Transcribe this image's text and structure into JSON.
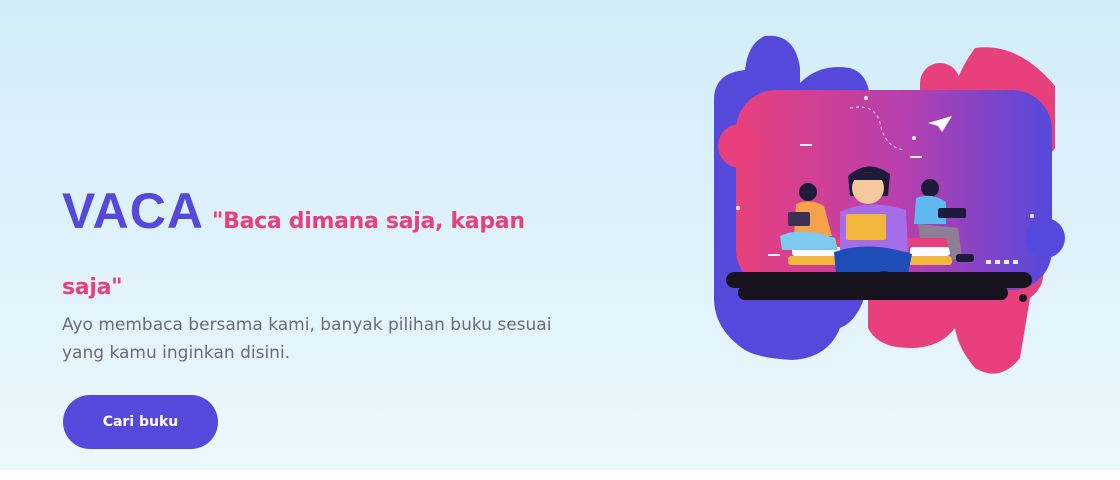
{
  "hero": {
    "brand": "VACA",
    "tagline_line1": "\"Baca dimana saja, kapan",
    "tagline_line2": "saja\"",
    "description_line1": "Ayo membaca bersama kami, banyak pilihan buku sesuai",
    "description_line2": "yang kamu inginkan disini.",
    "cta_label": "Cari buku"
  },
  "illustration": {
    "icon": "people-reading-books-illustration",
    "colors": {
      "purple": "#5549dc",
      "pink": "#e8407c",
      "dark": "#16121e"
    }
  },
  "colors": {
    "brand": "#5549dc",
    "accent": "#e8407c",
    "text_muted": "#6c6c7a",
    "background_top": "#d2edf8",
    "background_bottom": "#ecf8fd"
  }
}
